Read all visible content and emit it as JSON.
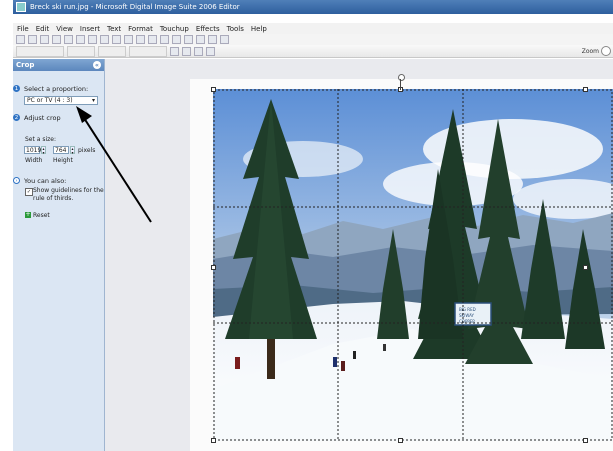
{
  "window": {
    "title": "Breck ski run.jpg - Microsoft Digital Image Suite 2006 Editor"
  },
  "menu": [
    "File",
    "Edit",
    "View",
    "Insert",
    "Text",
    "Format",
    "Touchup",
    "Effects",
    "Tools",
    "Help"
  ],
  "toolbar2": {
    "zoom_label": "Zoom"
  },
  "sidebar": {
    "title": "Crop",
    "step1_num": "1",
    "step1_label": "Select a proportion:",
    "proportion_value": "PC or TV (4 : 3)",
    "step2_num": "2",
    "step2_label": "Adjust crop",
    "set_size_label": "Set a size:",
    "width_value": "1019",
    "height_value": "764",
    "units_label": "pixels",
    "width_label": "Width",
    "height_label": "Height",
    "can_also_label": "You can also:",
    "guidelines_label_1": "Show guidelines for the",
    "guidelines_label_2": "rule of thirds.",
    "guidelines_checked": true,
    "reset_label": "Reset"
  },
  "photo": {
    "sign_text": "BIG RED\nSKIWAY\nCOPPER\nTRAIL"
  }
}
